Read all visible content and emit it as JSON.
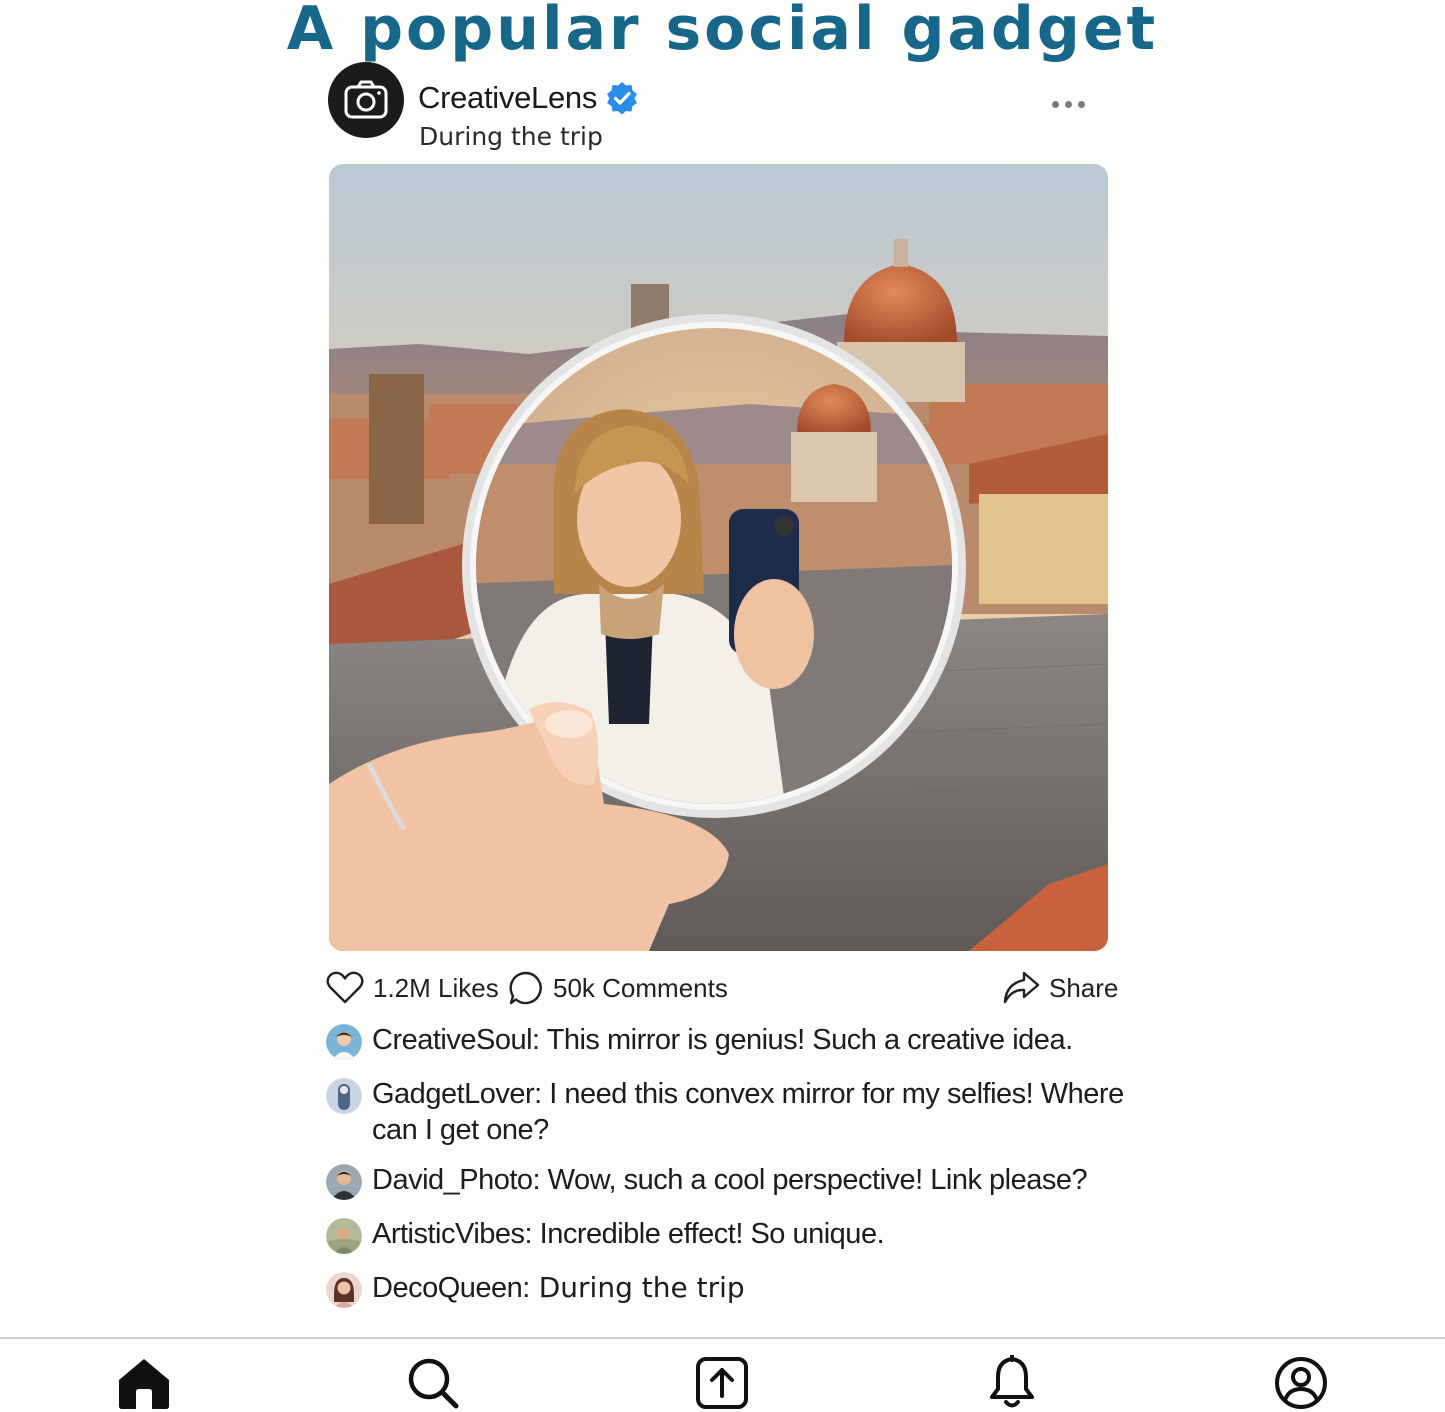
{
  "headline": "A popular social gadget",
  "post": {
    "username": "CreativeLens",
    "verified": true,
    "subtitle": "During the trip",
    "likes_label": "1.2M Likes",
    "comments_label": "50k Comments",
    "share_label": "Share"
  },
  "comments": [
    {
      "user": "CreativeSoul:",
      "text": " This mirror is genius! Such a creative idea."
    },
    {
      "user": "GadgetLover:",
      "text": " I need this convex mirror for my selfies! Where can I get one?"
    },
    {
      "user": "David_Photo:",
      "text": " Wow, such a cool perspective! Link please?"
    },
    {
      "user": "ArtisticVibes:",
      "text": " Incredible effect! So unique."
    },
    {
      "user": "DecoQueen:",
      "text": " During the trip"
    }
  ],
  "icons": {
    "home": "home-icon",
    "search": "search-icon",
    "upload": "upload-icon",
    "notifications": "bell-icon",
    "profile": "profile-icon",
    "like": "heart-icon",
    "comment": "comment-icon",
    "share": "share-icon",
    "more": "more-dots-icon",
    "camera": "camera-icon",
    "verified": "verified-badge-icon"
  },
  "colors": {
    "headline": "#16678a",
    "verified": "#2a8de8",
    "text": "#1d1d1d"
  }
}
